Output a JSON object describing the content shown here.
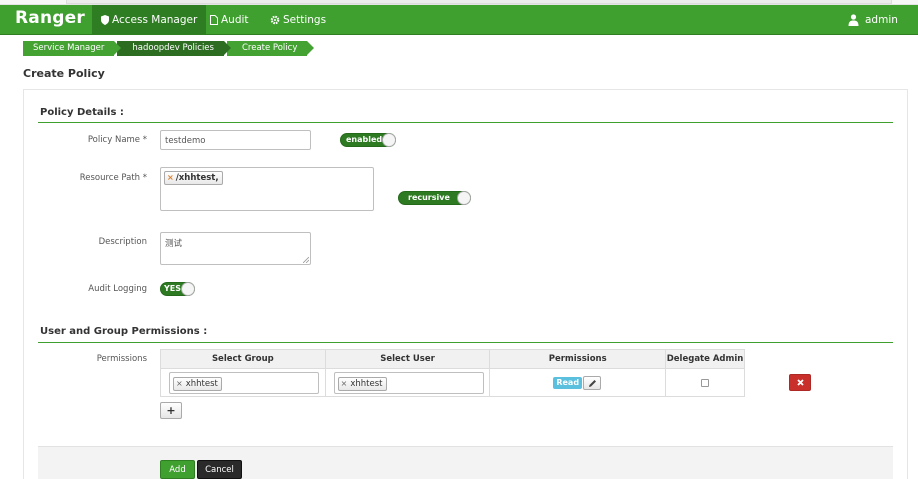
{
  "navbar": {
    "brand": "Ranger",
    "items": [
      {
        "label": "Access Manager",
        "active": true
      },
      {
        "label": "Audit",
        "active": false
      },
      {
        "label": "Settings",
        "active": false
      }
    ],
    "user": "admin"
  },
  "breadcrumb": [
    "Service Manager",
    "hadoopdev Policies",
    "Create Policy"
  ],
  "page": {
    "title": "Create Policy"
  },
  "policy_details": {
    "title": "Policy Details :",
    "policy_name_label": "Policy Name *",
    "policy_name_value": "testdemo",
    "enabled_toggle": "enabled",
    "resource_path_label": "Resource Path *",
    "resource_path_tag": "/xhhtest,",
    "recursive_toggle": "recursive",
    "description_label": "Description",
    "description_value": "测试",
    "audit_logging_label": "Audit Logging",
    "audit_logging_toggle": "YES"
  },
  "permissions_section": {
    "title": "User and Group Permissions :",
    "label": "Permissions",
    "columns": [
      "Select Group",
      "Select User",
      "Permissions",
      "Delegate Admin"
    ],
    "rows": [
      {
        "group": "xhhtest",
        "user": "xhhtest",
        "permission": "Read",
        "delegate_admin": false
      }
    ]
  },
  "buttons": {
    "add": "Add",
    "cancel": "Cancel",
    "add_row": "+"
  },
  "colors": {
    "brand_green": "#3f9f2f",
    "dark_green": "#2e7d22",
    "delete_red": "#c9302c",
    "read_badge": "#5bc0de"
  },
  "icons": [
    "shield-icon",
    "document-icon",
    "gear-icon",
    "user-icon",
    "pencil-icon",
    "close-icon",
    "plus-icon"
  ]
}
